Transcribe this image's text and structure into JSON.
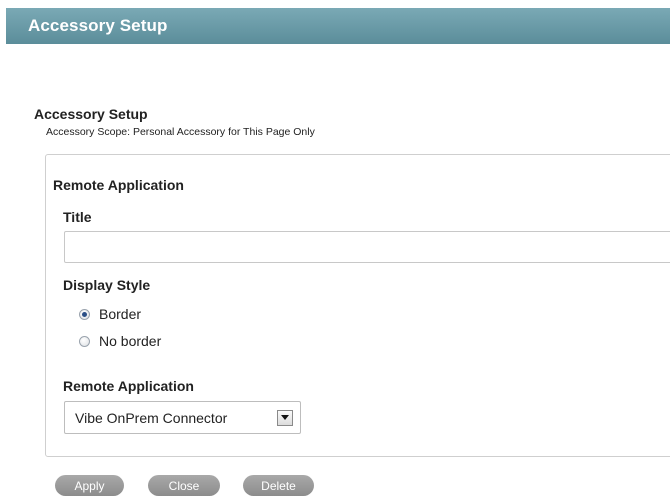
{
  "window": {
    "title": "Accessory Setup"
  },
  "setup": {
    "heading": "Accessory Setup",
    "scope": "Accessory Scope: Personal Accessory for This Page Only"
  },
  "form": {
    "section_title": "Remote Application",
    "title_label": "Title",
    "title_value": "",
    "title_placeholder": "",
    "display_style_label": "Display Style",
    "display_style_options": [
      "Border",
      "No border"
    ],
    "display_style_selected": "Border",
    "remote_app_label": "Remote Application",
    "remote_app_selected": "Vibe OnPrem Connector"
  },
  "buttons": {
    "apply": "Apply",
    "close": "Close",
    "delete": "Delete"
  },
  "colors": {
    "title_bar": "#6a9aa7",
    "radio_checked": "#2b4f86",
    "button_bg": "#9b9b9b"
  }
}
